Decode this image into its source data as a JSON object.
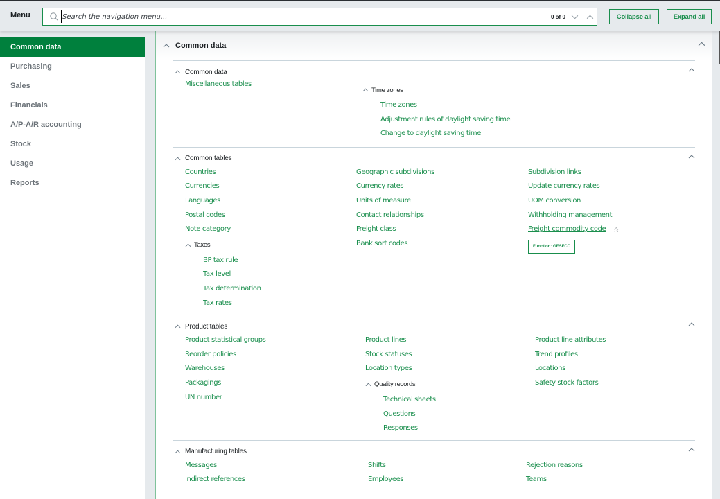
{
  "header": {
    "menu_label": "Menu",
    "search_placeholder": "Search the navigation menu...",
    "search_value": "",
    "match_counter": "0 of 0",
    "collapse_all": "Collapse all",
    "expand_all": "Expand all"
  },
  "sidebar": {
    "items": [
      {
        "label": "Common data",
        "active": true
      },
      {
        "label": "Purchasing"
      },
      {
        "label": "Sales"
      },
      {
        "label": "Financials"
      },
      {
        "label": "A/P-A/R accounting"
      },
      {
        "label": "Stock"
      },
      {
        "label": "Usage"
      },
      {
        "label": "Reports"
      }
    ]
  },
  "main": {
    "title": "Common data",
    "sections": {
      "common_data": {
        "title": "Common data",
        "col1": [
          "Miscellaneous tables"
        ],
        "time_zones": {
          "title": "Time zones",
          "links": [
            "Time zones",
            "Adjustment rules of daylight saving time",
            "Change to daylight saving time"
          ]
        }
      },
      "common_tables": {
        "title": "Common tables",
        "col1": [
          "Countries",
          "Currencies",
          "Languages",
          "Postal codes",
          "Note category"
        ],
        "taxes": {
          "title": "Taxes",
          "links": [
            "BP tax rule",
            "Tax level",
            "Tax determination",
            "Tax rates"
          ]
        },
        "col2": [
          "Geographic subdivisions",
          "Currency rates",
          "Units of measure",
          "Contact relationships",
          "Freight class",
          "Bank sort codes"
        ],
        "col3": [
          "Subdivision links",
          "Update currency rates",
          "UOM conversion",
          "Withholding management",
          "Freight commodity code"
        ],
        "function_badge": "Function: GESFCC"
      },
      "product_tables": {
        "title": "Product tables",
        "col1": [
          "Product statistical groups",
          "Reorder policies",
          "Warehouses",
          "Packagings",
          "UN number"
        ],
        "col2": [
          "Product lines",
          "Stock statuses",
          "Location types"
        ],
        "quality_records": {
          "title": "Quality records",
          "links": [
            "Technical sheets",
            "Questions",
            "Responses"
          ]
        },
        "col3": [
          "Product line attributes",
          "Trend profiles",
          "Locations",
          "Safety stock factors"
        ]
      },
      "manufacturing_tables": {
        "title": "Manufacturing tables",
        "col1": [
          "Messages",
          "Indirect references"
        ],
        "col2": [
          "Shifts",
          "Employees"
        ],
        "col3": [
          "Rejection reasons",
          "Teams"
        ]
      }
    }
  },
  "colors": {
    "accent": "#00803d",
    "link": "#198e4c",
    "background": "#e6eaed"
  }
}
